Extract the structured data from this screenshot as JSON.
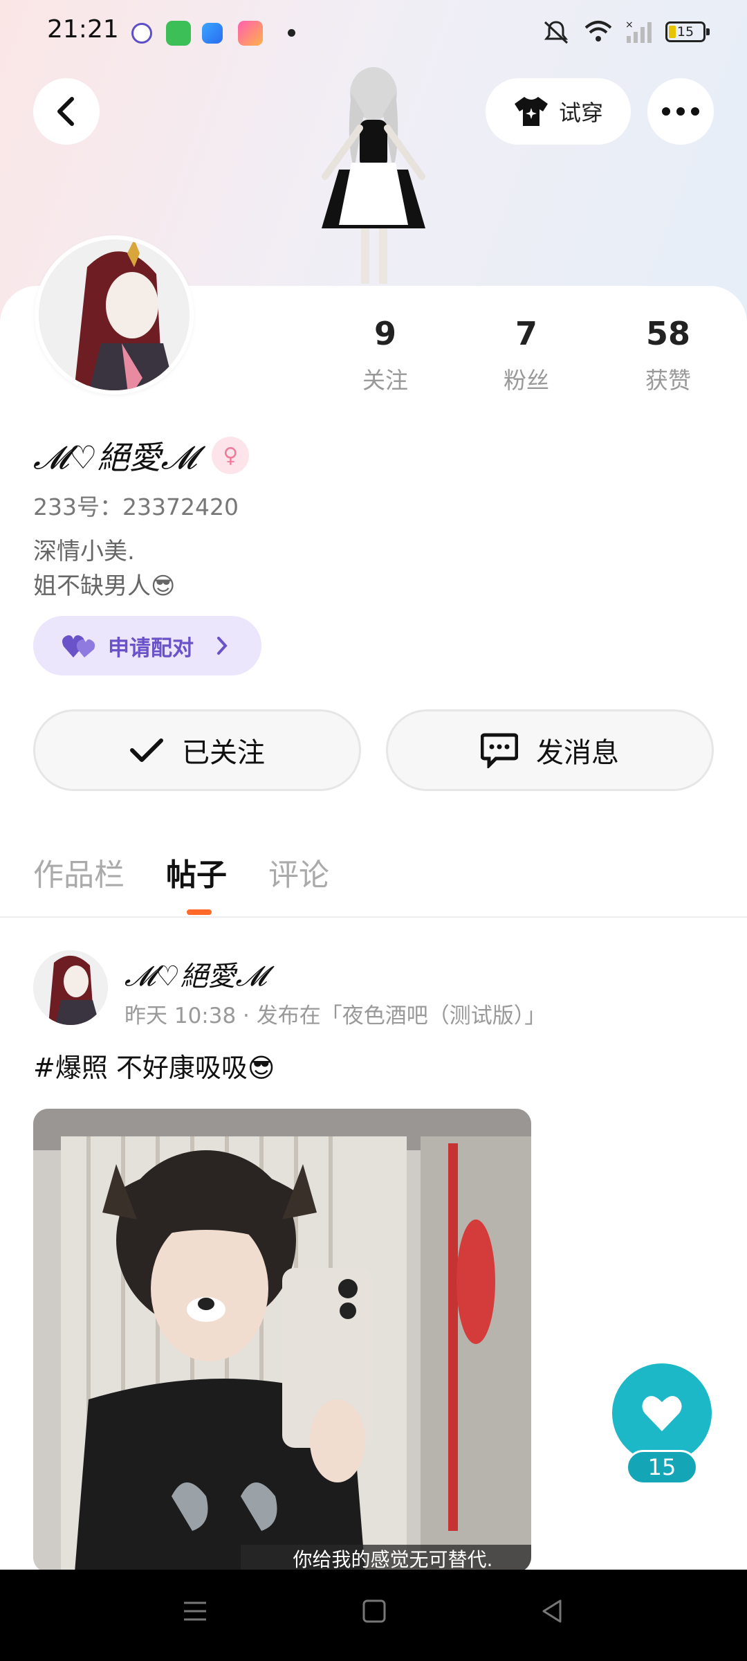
{
  "status_bar": {
    "time": "21:21",
    "battery": "15",
    "icons": [
      "notification-app-icon",
      "store-app-icon",
      "tool-app-icon",
      "video-app-icon",
      "mute-icon",
      "wifi-icon",
      "signal-icon",
      "battery-icon"
    ]
  },
  "header": {
    "back_icon": "chevron-left-icon",
    "try_on_label": "试穿",
    "more_icon": "more-dots-icon"
  },
  "profile": {
    "nickname": "𝓜♡絕愛𝓜",
    "gender_icon": "female-icon",
    "uid": "233号：23372420",
    "bio_line1": "深情小美.",
    "bio_line2": "姐不缺男人😎",
    "pair_label": "申请配对",
    "stats": [
      {
        "num": "9",
        "label": "关注"
      },
      {
        "num": "7",
        "label": "粉丝"
      },
      {
        "num": "58",
        "label": "获赞"
      }
    ]
  },
  "actions": {
    "following_label": "已关注",
    "message_label": "发消息"
  },
  "tabs": [
    {
      "label": "作品栏",
      "active": false
    },
    {
      "label": "帖子",
      "active": true
    },
    {
      "label": "评论",
      "active": false
    }
  ],
  "post": {
    "author": "𝓜♡絕愛𝓜",
    "meta": "昨天 10:38 · 发布在「夜色酒吧（测试版）」",
    "text": "#爆照 不好康吸吸😎",
    "image_caption": "你给我的感觉无可替代."
  },
  "like": {
    "count": "15"
  },
  "colors": {
    "accent_orange": "#ff6a2b",
    "like_teal": "#1cb8c8",
    "pair_purple": "#6a52c8"
  }
}
